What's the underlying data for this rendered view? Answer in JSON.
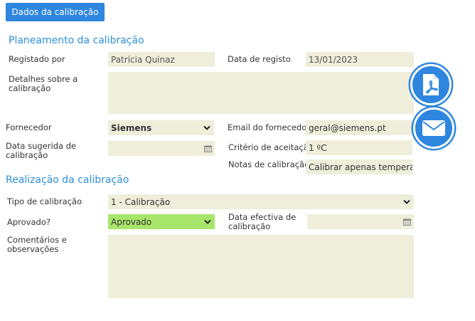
{
  "header": {
    "tab_label": "Dados da calibração"
  },
  "planning": {
    "title": "Planeamento da calibração",
    "registered_by_label": "Registado por",
    "registered_by_value": "Patrícia Quinaz",
    "register_date_label": "Data de registo",
    "register_date_value": "13/01/2023",
    "details_label": "Detalhes sobre a calibração",
    "details_value": "",
    "supplier_label": "Fornecedor",
    "supplier_value": "Siemens",
    "supplier_email_label": "Email do fornecedor",
    "supplier_email_value": "geral@siemens.pt",
    "suggested_date_label": "Data sugerida de calibração",
    "suggested_date_value": "",
    "acceptance_label": "Critério de aceitação",
    "acceptance_value": "1 ºC",
    "notes_label": "Notas de calibração",
    "notes_value": "Calibrar apenas temperatura"
  },
  "execution": {
    "title": "Realização da calibração",
    "type_label": "Tipo de calibração",
    "type_value": "1 - Calibração",
    "approved_label": "Aprovado?",
    "approved_value": "Aprovado",
    "effective_date_label": "Data efectiva de calibração",
    "effective_date_value": "",
    "comments_label": "Comentários e observações",
    "comments_value": ""
  },
  "actions": {
    "pdf_icon": "pdf-icon",
    "email_icon": "envelope-icon"
  },
  "colors": {
    "accent": "#2e86de",
    "field_bg": "#eeeedb",
    "approved_bg": "#a8e66b",
    "title_blue": "#2e8fd8"
  }
}
